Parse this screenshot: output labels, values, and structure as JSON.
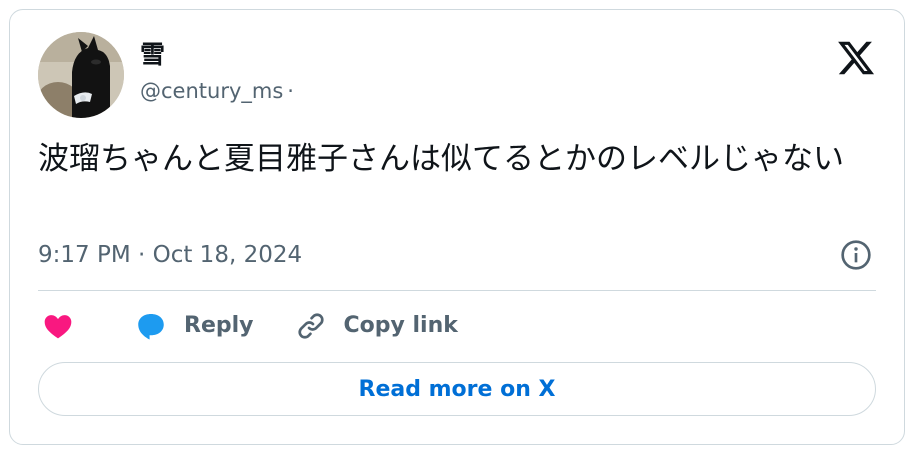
{
  "author": {
    "display_name": "雪",
    "handle": "@century_ms",
    "handle_separator": "·"
  },
  "tweet": {
    "text": "波瑠ちゃんと夏目雅子さんは似てるとかのレベルじゃない",
    "timestamp": "9:17 PM · Oct 18, 2024"
  },
  "actions": {
    "like_icon": "heart-icon",
    "reply_label": "Reply",
    "reply_icon": "speech-bubble-icon",
    "copy_link_label": "Copy link",
    "copy_link_icon": "link-icon"
  },
  "footer": {
    "read_more_label": "Read more on X"
  },
  "colors": {
    "like": "#f91880",
    "reply": "#1d9bf0",
    "link_text": "#006fd6",
    "secondary_text": "#536471",
    "border": "#cfd9de"
  }
}
